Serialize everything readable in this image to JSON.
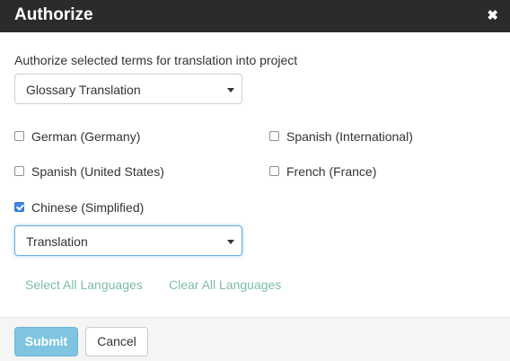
{
  "dialog": {
    "title": "Authorize",
    "close_glyph": "✖"
  },
  "form": {
    "prompt": "Authorize selected terms for translation into project",
    "project_select": {
      "selected": "Glossary Translation"
    },
    "languages": [
      {
        "label": "German (Germany)",
        "checked": false
      },
      {
        "label": "Spanish (International)",
        "checked": false
      },
      {
        "label": "Spanish (United States)",
        "checked": false
      },
      {
        "label": "French (France)",
        "checked": false
      },
      {
        "label": "Chinese (Simplified)",
        "checked": true
      }
    ],
    "workflow_select": {
      "selected": "Translation"
    },
    "select_all": "Select All Languages",
    "clear_all": "Clear All Languages"
  },
  "footer": {
    "submit_label": "Submit",
    "cancel_label": "Cancel"
  },
  "colors": {
    "header": "#2b2b2b",
    "link": "#7fbca8",
    "submit": "#7fc5e2",
    "checkbox_checked": "#3b86e8"
  }
}
